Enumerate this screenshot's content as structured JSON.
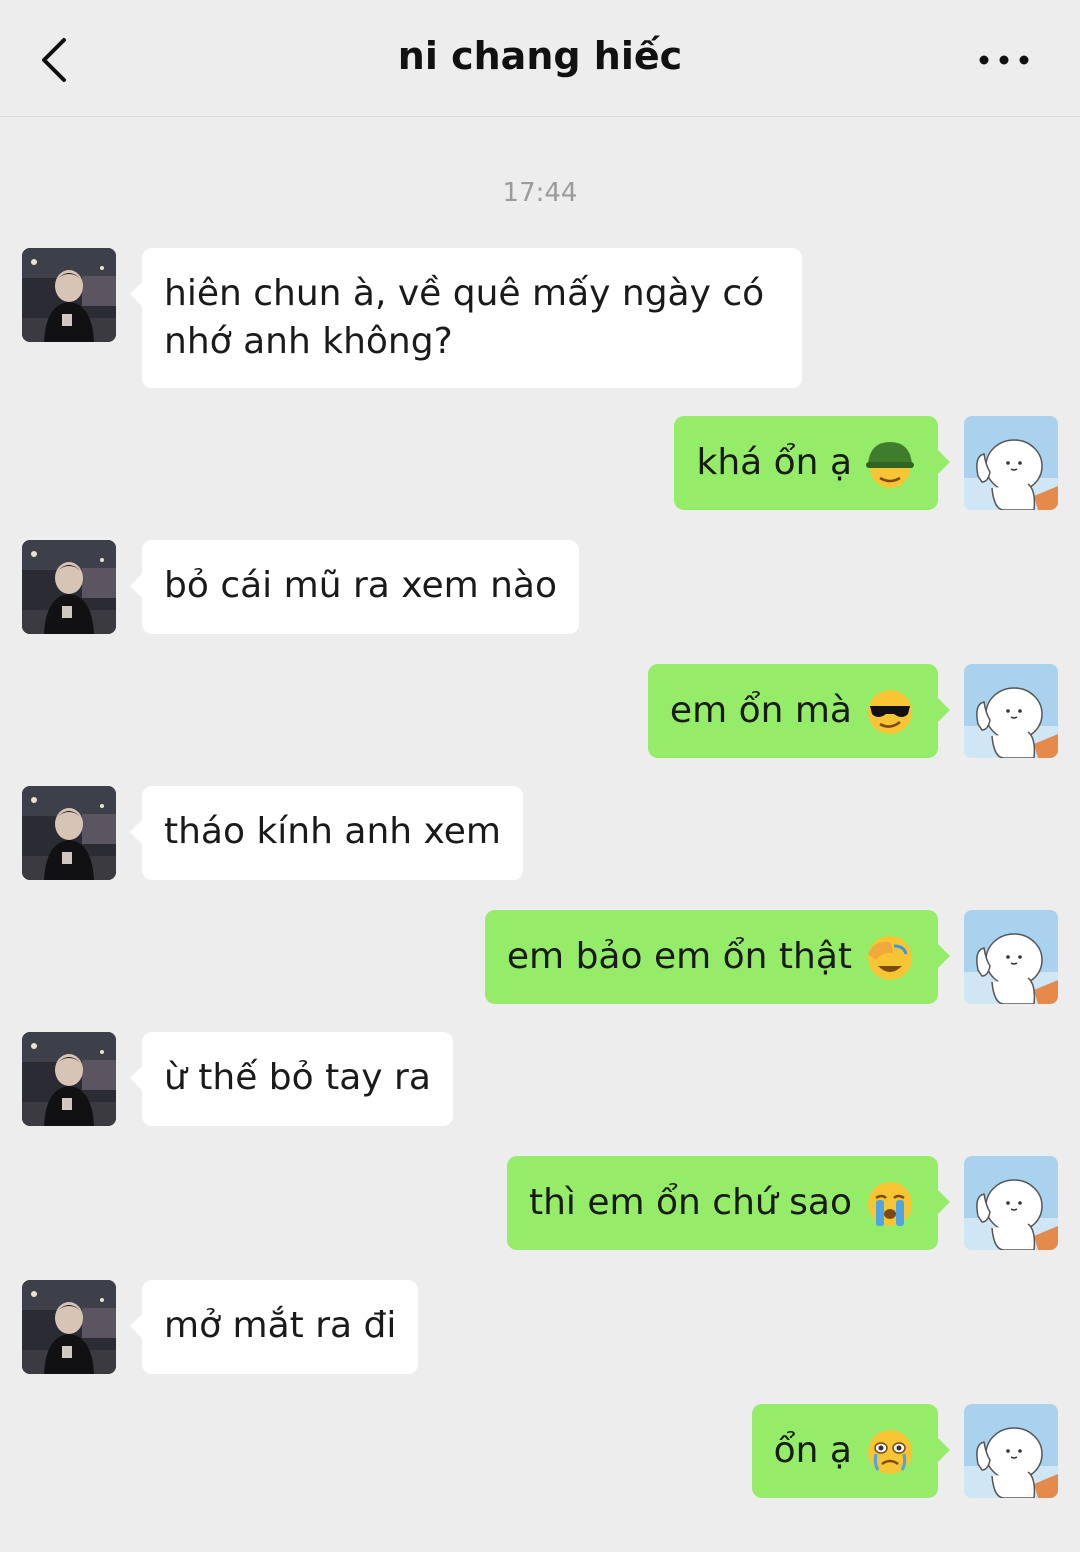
{
  "header": {
    "title": "ni chang hiếc",
    "back_icon": "chevron-left-icon",
    "more_icon": "more-dots-icon"
  },
  "timestamp": "17:44",
  "messages": [
    {
      "side": "in",
      "text": "hiên chun à, về quê mấy ngày có nhớ anh không?"
    },
    {
      "side": "out",
      "text": "khá ổn ạ",
      "emoji": "helmet-smile-icon"
    },
    {
      "side": "in",
      "text": "bỏ cái mũ ra xem nào"
    },
    {
      "side": "out",
      "text": "em ổn mà",
      "emoji": "sunglasses-smile-icon"
    },
    {
      "side": "in",
      "text": "tháo kính anh xem"
    },
    {
      "side": "out",
      "text": "em bảo em ổn thật",
      "emoji": "facepalm-laugh-icon"
    },
    {
      "side": "in",
      "text": "ừ thế bỏ tay ra"
    },
    {
      "side": "out",
      "text": "thì em ổn chứ sao",
      "emoji": "crying-face-icon"
    },
    {
      "side": "in",
      "text": "mở mắt ra đi"
    },
    {
      "side": "out",
      "text": "ổn ạ",
      "emoji": "crying-squint-icon"
    }
  ]
}
